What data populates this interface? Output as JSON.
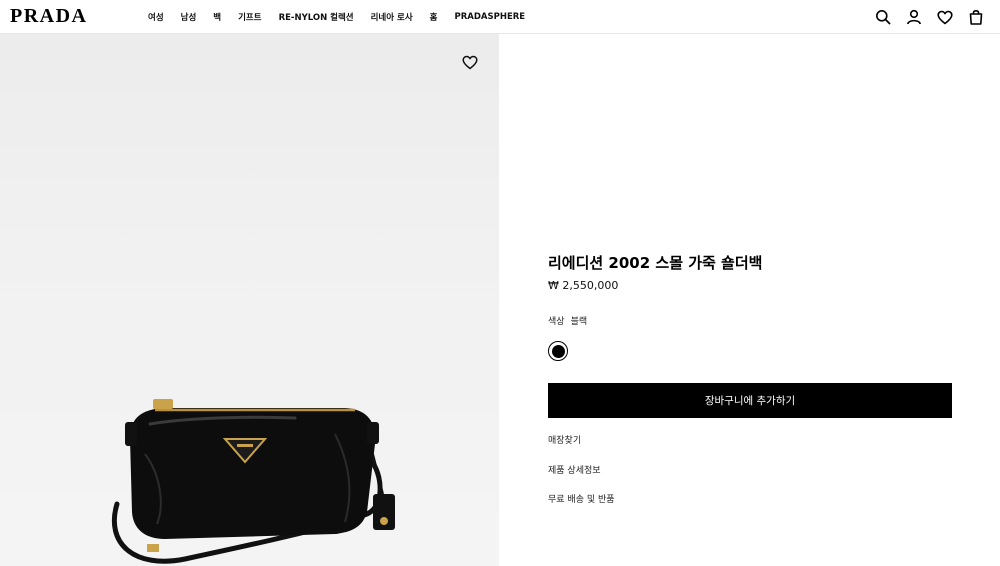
{
  "header": {
    "logo": "PRADA",
    "nav": [
      "여성",
      "남성",
      "백",
      "기프트",
      "RE-NYLON 컬렉션",
      "리네아 로사",
      "홈",
      "PRADASPHERE"
    ],
    "icons": [
      "search-icon",
      "account-icon",
      "wishlist-icon",
      "bag-icon"
    ]
  },
  "product": {
    "title": "리에디션 2002 스몰 가죽 숄더백",
    "price": "₩ 2,550,000",
    "color_label": "색상",
    "color_value": "블랙",
    "swatch_color": "#000000",
    "add_to_cart": "장바구니에 추가하기",
    "links": [
      "매장찾기",
      "제품 상세정보",
      "무료 배송 및 반품"
    ]
  },
  "colors": {
    "accent": "#000000",
    "image_bg": "#efefef",
    "divider": "#e6e6e6"
  }
}
